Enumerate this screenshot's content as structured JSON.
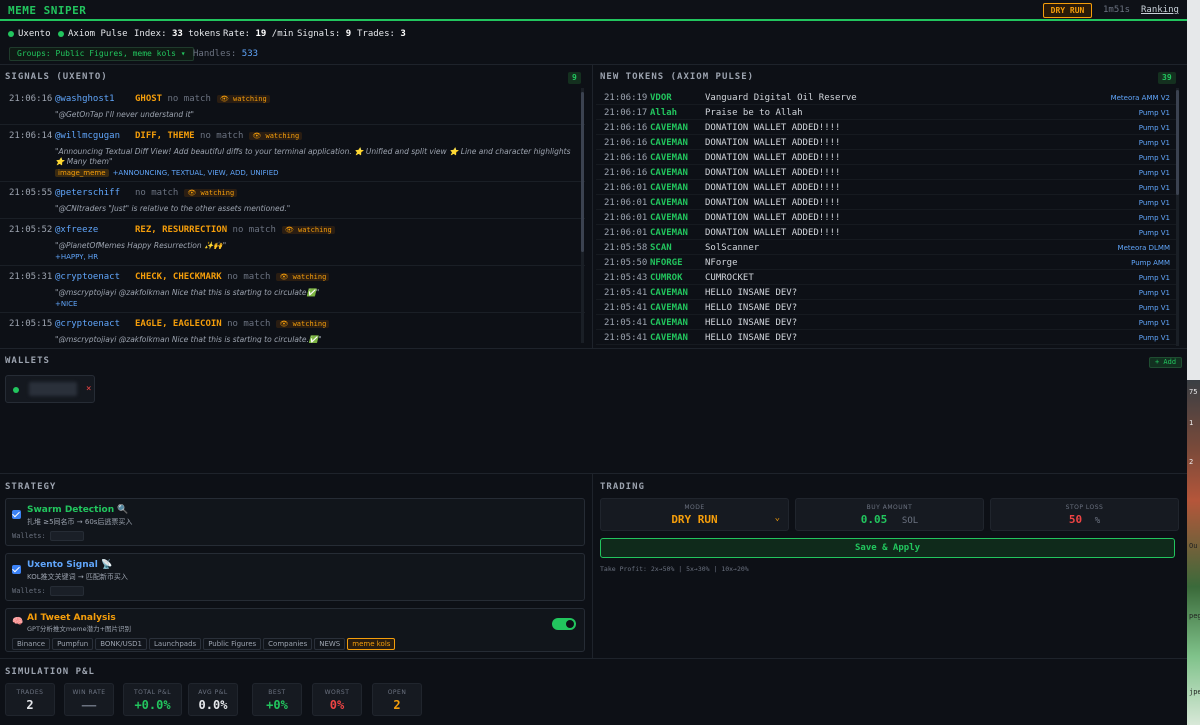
{
  "app": {
    "title": "MEME SNIPER",
    "mode_badge": "DRY RUN",
    "uptime": "1m51s",
    "ranking_link": "Ranking"
  },
  "status": {
    "source1": "Uxento",
    "source2": "Axiom Pulse",
    "index_label": "Index:",
    "index_value": "33",
    "index_unit": "tokens",
    "rate_label": "Rate:",
    "rate_value": "19",
    "rate_unit": "/min",
    "signals_label": "Signals:",
    "signals_value": "9",
    "trades_label": "Trades:",
    "trades_value": "3"
  },
  "groups": {
    "button": "Groups: Public Figures, meme kols ▾",
    "handles_label": "Handles:",
    "handles_value": "533"
  },
  "signals_panel": {
    "title": "SIGNALS (UXENTO)",
    "count": "9",
    "items": [
      {
        "time": "21:06:16",
        "handle": "@washghost1",
        "keywords": "GHOST",
        "match": "no match",
        "status": "👁 watching",
        "quote": "\"@GetOnTap I'll never understand it\"",
        "image_tag": "",
        "tags": ""
      },
      {
        "time": "21:06:14",
        "handle": "@willmcgugan",
        "keywords": "DIFF, THEME",
        "match": "no match",
        "status": "👁 watching",
        "quote": "\"Announcing Textual Diff View! Add beautiful diffs to your terminal application. ⭐ Unified and split view ⭐ Line and character highlights ⭐ Many them\"",
        "image_tag": "image_meme",
        "tags": "+ANNOUNCING, TEXTUAL, VIEW, ADD, UNIFIED"
      },
      {
        "time": "21:05:55",
        "handle": "@peterschiff",
        "keywords": "",
        "match": "no match",
        "status": "👁 watching",
        "quote": "\"@CNItraders \"Just\" is relative to the other assets mentioned.\"",
        "image_tag": "",
        "tags": ""
      },
      {
        "time": "21:05:52",
        "handle": "@xfreeze",
        "keywords": "REZ, RESURRECTION",
        "match": "no match",
        "status": "👁 watching",
        "quote": "\"@PlanetOfMemes Happy Resurrection ✨🙌\"",
        "image_tag": "",
        "tags": "+HAPPY, HR"
      },
      {
        "time": "21:05:31",
        "handle": "@cryptoenact",
        "keywords": "CHECK, CHECKMARK",
        "match": "no match",
        "status": "👁 watching",
        "quote": "\"@mscryptojiayi @zakfolkman Nice that this is starting to circulate✅\"",
        "image_tag": "",
        "tags": "+NICE"
      },
      {
        "time": "21:05:15",
        "handle": "@cryptoenact",
        "keywords": "EAGLE, EAGLECOIN",
        "match": "no match",
        "status": "👁 watching",
        "quote": "\"@mscryptojiayi @zakfolkman Nice that this is starting to circulate.✅\"",
        "image_tag": "",
        "tags": "+NICE"
      }
    ]
  },
  "tokens_panel": {
    "title": "NEW TOKENS (AXIOM PULSE)",
    "count": "39",
    "items": [
      {
        "time": "21:06:19",
        "symbol": "VDOR",
        "name": "Vanguard Digital Oil Reserve",
        "platform": "Meteora AMM V2"
      },
      {
        "time": "21:06:17",
        "symbol": "Allah",
        "name": "Praise be to Allah",
        "platform": "Pump V1"
      },
      {
        "time": "21:06:16",
        "symbol": "CAVEMAN",
        "name": "DONATION WALLET ADDED!!!!",
        "platform": "Pump V1"
      },
      {
        "time": "21:06:16",
        "symbol": "CAVEMAN",
        "name": "DONATION WALLET ADDED!!!!",
        "platform": "Pump V1"
      },
      {
        "time": "21:06:16",
        "symbol": "CAVEMAN",
        "name": "DONATION WALLET ADDED!!!!",
        "platform": "Pump V1"
      },
      {
        "time": "21:06:16",
        "symbol": "CAVEMAN",
        "name": "DONATION WALLET ADDED!!!!",
        "platform": "Pump V1"
      },
      {
        "time": "21:06:01",
        "symbol": "CAVEMAN",
        "name": "DONATION WALLET ADDED!!!!",
        "platform": "Pump V1"
      },
      {
        "time": "21:06:01",
        "symbol": "CAVEMAN",
        "name": "DONATION WALLET ADDED!!!!",
        "platform": "Pump V1"
      },
      {
        "time": "21:06:01",
        "symbol": "CAVEMAN",
        "name": "DONATION WALLET ADDED!!!!",
        "platform": "Pump V1"
      },
      {
        "time": "21:06:01",
        "symbol": "CAVEMAN",
        "name": "DONATION WALLET ADDED!!!!",
        "platform": "Pump V1"
      },
      {
        "time": "21:05:58",
        "symbol": "SCAN",
        "name": "SolScanner",
        "platform": "Meteora DLMM"
      },
      {
        "time": "21:05:50",
        "symbol": "NFORGE",
        "name": "NForge",
        "platform": "Pump AMM"
      },
      {
        "time": "21:05:43",
        "symbol": "CUMROK",
        "name": "CUMROCKET",
        "platform": "Pump V1"
      },
      {
        "time": "21:05:41",
        "symbol": "CAVEMAN",
        "name": "HELLO INSANE DEV?",
        "platform": "Pump V1"
      },
      {
        "time": "21:05:41",
        "symbol": "CAVEMAN",
        "name": "HELLO INSANE DEV?",
        "platform": "Pump V1"
      },
      {
        "time": "21:05:41",
        "symbol": "CAVEMAN",
        "name": "HELLO INSANE DEV?",
        "platform": "Pump V1"
      },
      {
        "time": "21:05:41",
        "symbol": "CAVEMAN",
        "name": "HELLO INSANE DEV?",
        "platform": "Pump V1"
      }
    ]
  },
  "wallets": {
    "title": "WALLETS",
    "add_button": "+ Add",
    "remove_glyph": "×"
  },
  "strategy": {
    "title": "STRATEGY",
    "items": [
      {
        "name": "Swarm Detection 🔍",
        "desc": "扎堆 ≥5同名币 → 60s后逃票买入",
        "wallets_label": "Wallets:",
        "color": "#22c55e"
      },
      {
        "name": "Uxento Signal 📡",
        "desc": "KOL推文关键词 → 匹配新币买入",
        "wallets_label": "Wallets:",
        "color": "#60a5fa"
      },
      {
        "name": "AI Tweet Analysis",
        "desc": "GPT分析推文meme潜力+图片识别",
        "color": "#f59e0b",
        "chips": [
          "Binance",
          "Pumpfun",
          "BONK/USD1",
          "Launchpads",
          "Public Figures",
          "Companies",
          "NEWS",
          "meme kols"
        ],
        "active_chip": "meme kols"
      }
    ]
  },
  "trading": {
    "title": "TRADING",
    "mode_label": "MODE",
    "mode_value": "DRY RUN",
    "buy_label": "BUY AMOUNT",
    "buy_value": "0.05",
    "buy_unit": "SOL",
    "stop_label": "STOP LOSS",
    "stop_value": "50",
    "stop_unit": "%",
    "save_button": "Save & Apply",
    "take_profit": "Take Profit: 2x→50% | 5x→30% | 10x→20%"
  },
  "simulation": {
    "title": "SIMULATION P&L",
    "stats": [
      {
        "label": "TRADES",
        "value": "2",
        "color": "#e5e7eb"
      },
      {
        "label": "WIN RATE",
        "value": "——",
        "color": "#6b7280"
      },
      {
        "label": "TOTAL P&L",
        "value": "+0.0%",
        "color": "#22c55e"
      },
      {
        "label": "AVG P&L",
        "value": "0.0%",
        "color": "#e5e7eb"
      },
      {
        "label": "BEST",
        "value": "+0%",
        "color": "#22c55e"
      },
      {
        "label": "WORST",
        "value": "0%",
        "color": "#ef4444"
      },
      {
        "label": "OPEN",
        "value": "2",
        "color": "#f59e0b"
      }
    ]
  },
  "side_strip": {
    "texts": [
      "75",
      "1",
      "2",
      "Ou",
      "peg",
      "jpe"
    ]
  },
  "colors": {
    "accent": "#22c55e",
    "warn": "#f59e0b",
    "link": "#60a5fa",
    "danger": "#ef4444",
    "bg": "#0d1016"
  }
}
